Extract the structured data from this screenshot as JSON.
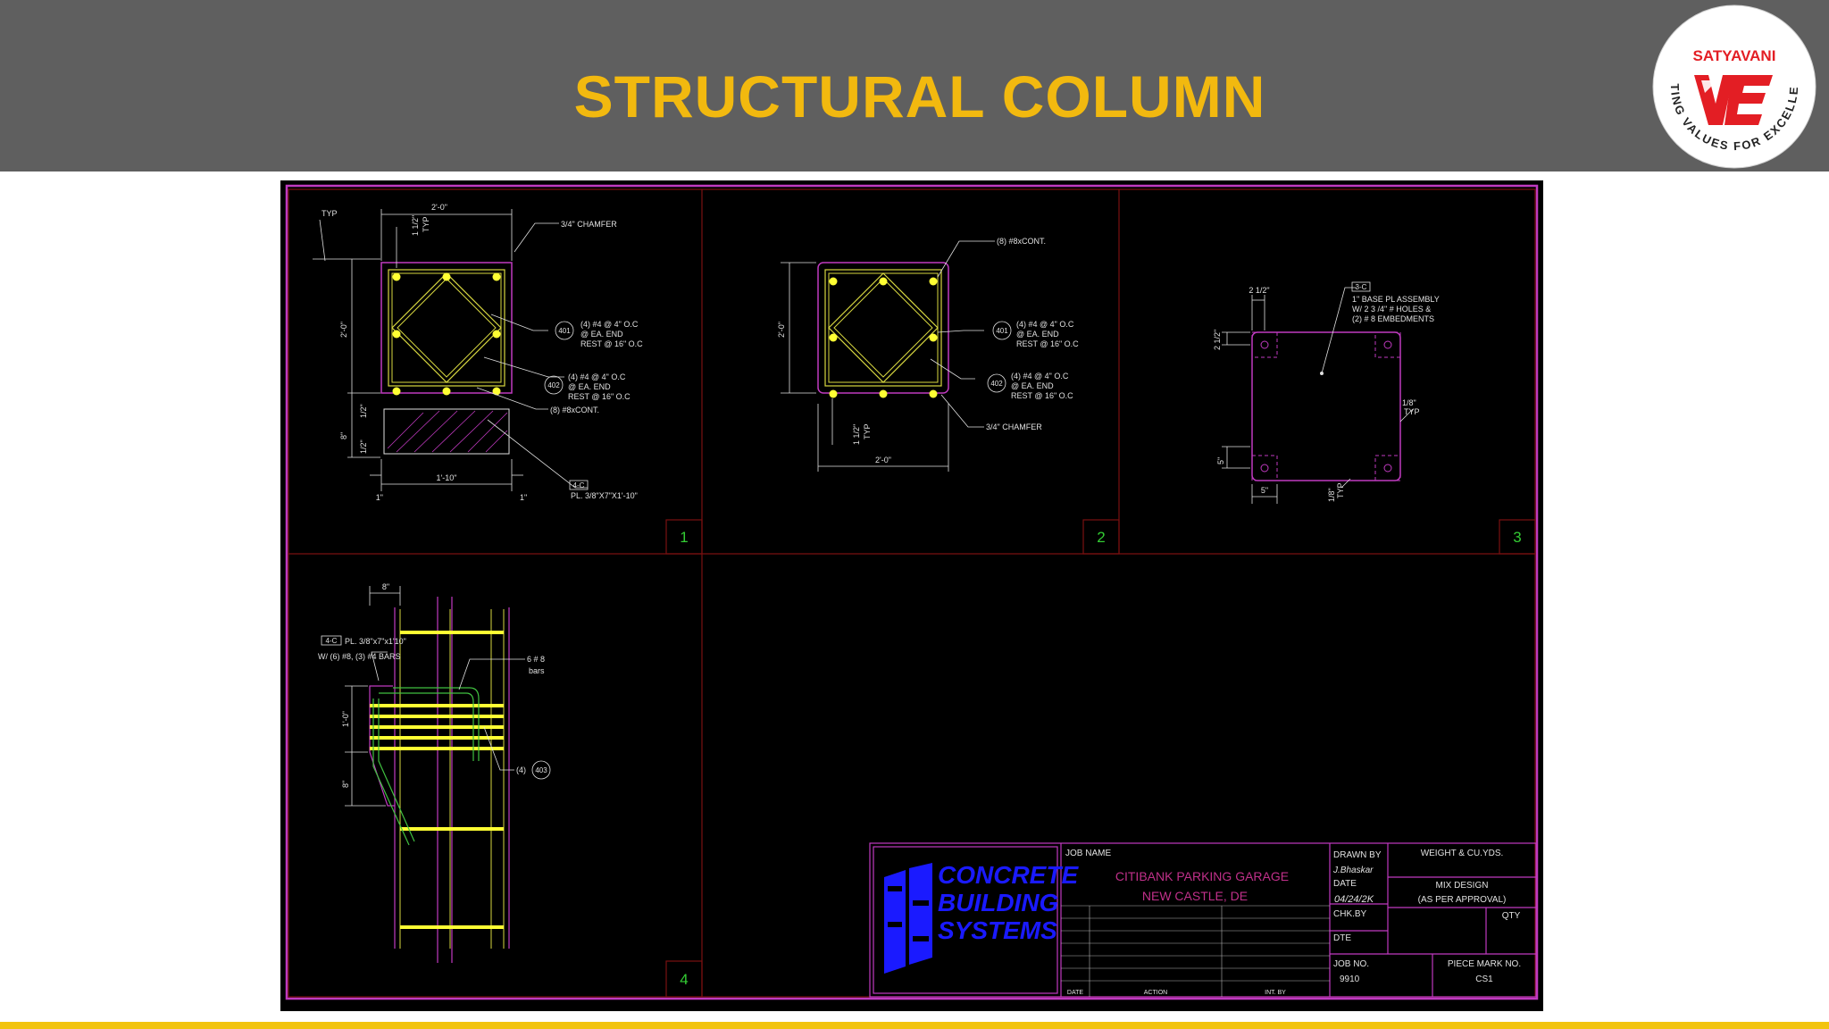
{
  "slide": {
    "title": "STRUCTURAL COLUMN",
    "accent_color": "#f2b90f",
    "header_bg": "#5f5f5f"
  },
  "logo": {
    "name": "SATYAVANI",
    "tagline": "SETTING VALUES FOR EXCELLENCE",
    "colors": [
      "#e31e24",
      "#ffffff"
    ]
  },
  "drawing": {
    "panels": [
      {
        "number": "1",
        "dims": [
          "2'-0\"",
          "1 1/2\"",
          "TYP",
          "TYP",
          "2'-0\"",
          "1/2\"",
          "8\"",
          "1/2\"",
          "1'-10\"",
          "1\"",
          "1\""
        ],
        "notes": [
          "3/4\" CHAMFER",
          "(4) #4 @ 4\" O.C",
          "@  EA. END",
          "REST @ 16\" O.C",
          "(4) #4 @ 4\" O.C",
          "@  EA. END",
          "REST @ 16\" O.C",
          "(8) #8xCONT.",
          "PL. 3/8\"X7\"X1'-10\""
        ],
        "tags": [
          "401",
          "402",
          "4-C"
        ]
      },
      {
        "number": "2",
        "dims": [
          "2'-0\"",
          "1 1/2\"",
          "TYP",
          "2'-0\""
        ],
        "notes": [
          "(8) #8xCONT.",
          "(4) #4 @ 4\" O.C",
          "@  EA. END",
          "REST @ 16\" O.C",
          "(4) #4 @ 4\" O.C",
          "@  EA. END",
          "REST @ 16\" O.C",
          "3/4\" CHAMFER"
        ],
        "tags": [
          "401",
          "402"
        ]
      },
      {
        "number": "3",
        "dims": [
          "2 1/2\"",
          "2 1/2\"",
          "1/8\"",
          "TYP",
          "5\"",
          "5\"",
          "1/8\"",
          "TYP"
        ],
        "notes": [
          "1\" BASE PL ASSEMBLY",
          "W/  2 3 /4\" # HOLES  &",
          "(2) # 8 EMBEDMENTS"
        ],
        "tags": [
          "3-C"
        ]
      },
      {
        "number": "4",
        "dims": [
          "8\"",
          "1'-0\"",
          "8\""
        ],
        "notes": [
          "PL. 3/8\"x7\"x1'10\"",
          "W/ (6) #8, (3) #4 BARS",
          "6 # 8",
          "bars",
          "(4)"
        ],
        "tags": [
          "4-C",
          "403"
        ]
      }
    ],
    "title_block": {
      "company": [
        "CONCRETE",
        "BUILDING",
        "SYSTEMS"
      ],
      "job_name_label": "JOB NAME",
      "job_name": [
        "CITIBANK  PARKING  GARAGE",
        "NEW  CASTLE,  DE"
      ],
      "drawn_by_label": "DRAWN BY",
      "drawn_by": "J.Bhaskar",
      "date_label": "DATE",
      "date": "04/24/2K",
      "chk_by_label": "CHK.BY",
      "dte_label": "DTE",
      "weight_label": "WEIGHT  &  CU.YDS.",
      "mix_design_label": "MIX  DESIGN",
      "mix_design_value": "(AS  PER  APPROVAL)",
      "qty_label": "QTY",
      "job_no_label": "JOB  NO.",
      "job_no": "9910",
      "piece_mark_label": "PIECE  MARK  NO.",
      "piece_mark": "CS1",
      "revision_headers": [
        "DATE",
        "ACTION",
        "INT. BY"
      ]
    },
    "colors": {
      "border": "#c03ac0",
      "grid": "#7a1010",
      "rebar": "#ffff33",
      "tie": "#d8d840",
      "text": "#e0e0e0",
      "panel_number": "#33cc33",
      "company": "#1a1aff",
      "job_name": "#c0308a"
    }
  }
}
